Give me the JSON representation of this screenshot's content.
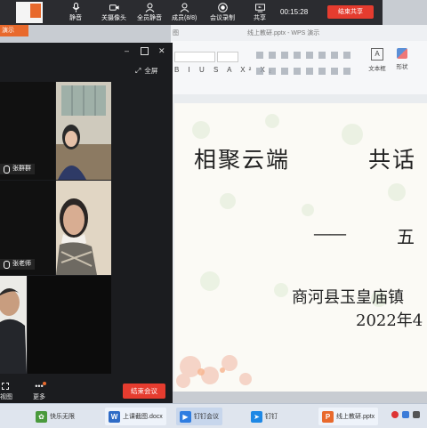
{
  "meeting_toolbar": {
    "buttons": [
      {
        "label": "静音"
      },
      {
        "label": "关摄像头"
      },
      {
        "label": "全员静音"
      },
      {
        "label": "成员(8/8)"
      },
      {
        "label": "会议录制"
      },
      {
        "label": "共享"
      }
    ],
    "time": "00:15:28",
    "end_share": "结束共享"
  },
  "wps": {
    "window_title": "线上教研.pptx - WPS 演示",
    "tab_fragment": "图",
    "text_box_label": "文本框",
    "shape_label": "形状",
    "edit_tab": "演示"
  },
  "video_panel": {
    "fullscreen": "全屏",
    "participants": [
      {
        "name": "张群群"
      },
      {
        "name": "张老师"
      }
    ],
    "view_label": "视图",
    "more_label": "更多",
    "end_meeting": "结束会议"
  },
  "slide": {
    "title_left": "相聚云端",
    "title_right": "共话",
    "dash": "——",
    "subtitle_partial": "五",
    "school": "商河县玉皇庙镇",
    "date": "2022年4"
  },
  "taskbar": {
    "items": [
      {
        "label": "快乐无限"
      },
      {
        "label": "上课截图.docx"
      },
      {
        "label": "钉钉会议"
      },
      {
        "label": "钉钉"
      },
      {
        "label": "线上教研.pptx"
      }
    ]
  }
}
